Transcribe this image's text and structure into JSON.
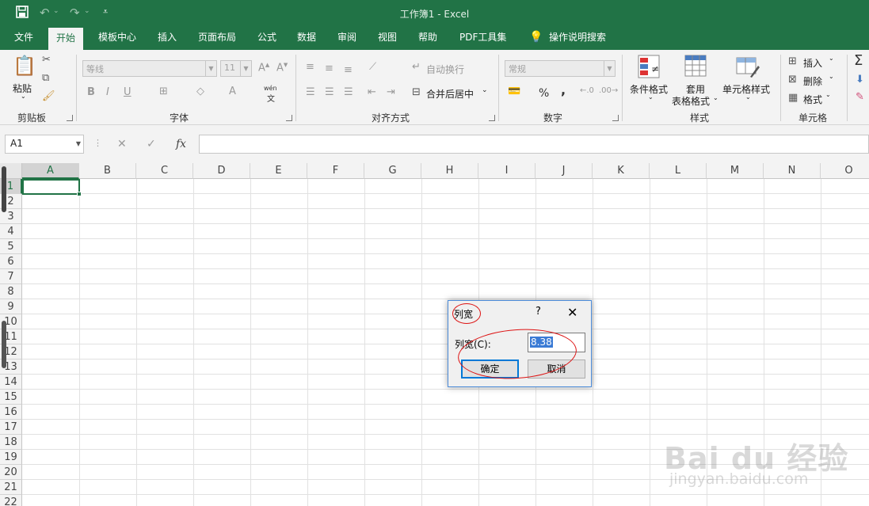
{
  "window": {
    "title": "工作簿1  -  Excel"
  },
  "quick_access": {
    "save_icon": "save-icon",
    "undo_icon": "undo-icon",
    "redo_icon": "redo-icon",
    "customize_icon": "customize-icon"
  },
  "tabs": [
    {
      "label": "文件"
    },
    {
      "label": "开始"
    },
    {
      "label": "模板中心"
    },
    {
      "label": "插入"
    },
    {
      "label": "页面布局"
    },
    {
      "label": "公式"
    },
    {
      "label": "数据"
    },
    {
      "label": "审阅"
    },
    {
      "label": "视图"
    },
    {
      "label": "帮助"
    },
    {
      "label": "PDF工具集"
    },
    {
      "label": "操作说明搜索"
    }
  ],
  "ribbon": {
    "clipboard": {
      "label": "剪贴板",
      "paste": "粘贴"
    },
    "font": {
      "label": "字体",
      "font_name": "等线",
      "font_size": "11",
      "wen": "wén",
      "wen_char": "文"
    },
    "alignment": {
      "label": "对齐方式",
      "wrap": "自动换行",
      "merge": "合并后居中"
    },
    "number": {
      "label": "数字",
      "format": "常规",
      "percent": "%",
      "comma": ","
    },
    "styles": {
      "label": "样式",
      "conditional": "条件格式",
      "table_1": "套用",
      "table_2": "表格格式",
      "cell_style": "单元格样式"
    },
    "cells": {
      "label": "单元格",
      "insert": "插入",
      "delete": "删除",
      "format": "格式"
    }
  },
  "formula_bar": {
    "name_box": "A1",
    "cancel": "✕",
    "enter": "✓",
    "fx": "fx",
    "value": ""
  },
  "columns": [
    "A",
    "B",
    "C",
    "D",
    "E",
    "F",
    "G",
    "H",
    "I",
    "J",
    "K",
    "L",
    "M",
    "N",
    "O"
  ],
  "rows": [
    "1",
    "2",
    "3",
    "4",
    "5",
    "6",
    "7",
    "8",
    "9",
    "10",
    "11",
    "12",
    "13",
    "14",
    "15",
    "16",
    "17",
    "18",
    "19",
    "20",
    "21",
    "22"
  ],
  "selected_cell": "A1",
  "dialog": {
    "title": "列宽",
    "help": "?",
    "close": "✕",
    "field_label": "列宽(C):",
    "field_value": "8.38",
    "ok": "确定",
    "cancel": "取消"
  },
  "watermark": {
    "logo": "Bai du 经验",
    "url": "jingyan.baidu.com"
  },
  "colors": {
    "accent": "#217346",
    "annotation": "#dd1111",
    "selection": "#3a7bd5"
  }
}
